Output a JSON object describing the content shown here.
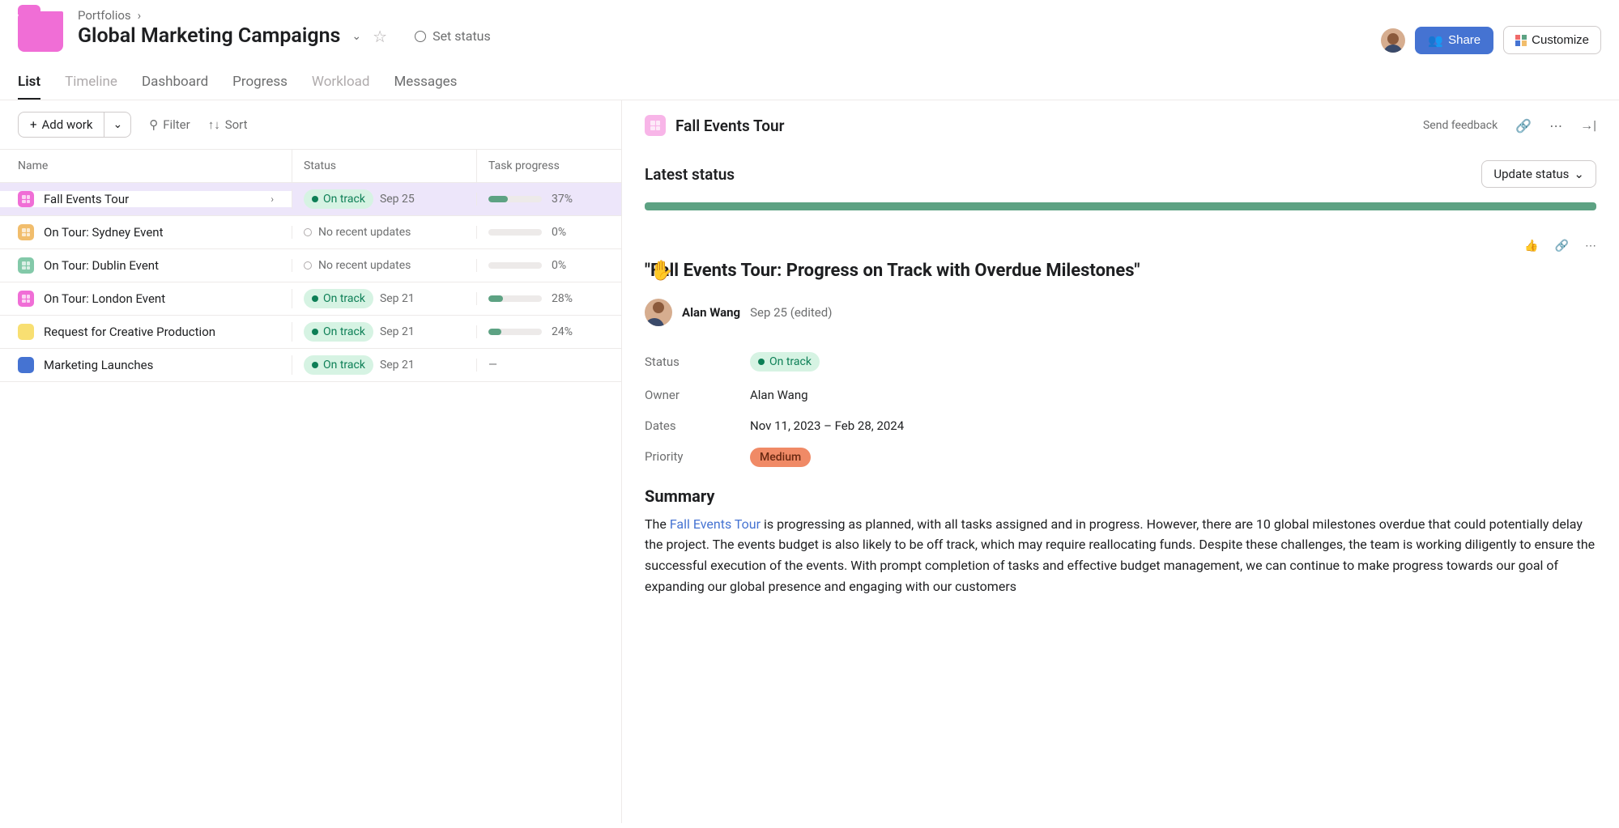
{
  "breadcrumb": {
    "parent": "Portfolios"
  },
  "page_title": "Global Marketing Campaigns",
  "set_status": "Set status",
  "share_label": "Share",
  "customize_label": "Customize",
  "tabs": {
    "list": "List",
    "timeline": "Timeline",
    "dashboard": "Dashboard",
    "progress": "Progress",
    "workload": "Workload",
    "messages": "Messages"
  },
  "toolbar": {
    "add_work": "Add work",
    "filter": "Filter",
    "sort": "Sort"
  },
  "columns": {
    "name": "Name",
    "status": "Status",
    "progress": "Task progress"
  },
  "rows": {
    "r0": {
      "name": "Fall Events Tour",
      "status_label": "On track",
      "status_date": "Sep 25",
      "pct": "37%",
      "fill": 37
    },
    "r1": {
      "name": "On Tour: Sydney Event",
      "nou": "No recent updates",
      "pct": "0%",
      "fill": 0
    },
    "r2": {
      "name": "On Tour: Dublin Event",
      "nou": "No recent updates",
      "pct": "0%",
      "fill": 0
    },
    "r3": {
      "name": "On Tour: London Event",
      "status_label": "On track",
      "status_date": "Sep 21",
      "pct": "28%",
      "fill": 28
    },
    "r4": {
      "name": "Request for Creative Production",
      "status_label": "On track",
      "status_date": "Sep 21",
      "pct": "24%",
      "fill": 24
    },
    "r5": {
      "name": "Marketing Launches",
      "status_label": "On track",
      "status_date": "Sep 21",
      "dash": "—"
    }
  },
  "detail": {
    "title": "Fall Events Tour",
    "send_feedback": "Send feedback",
    "latest_status": "Latest status",
    "update_status": "Update status",
    "update_title": "\"Fall Events Tour: Progress on Track with Overdue Milestones\"",
    "author": "Alan Wang",
    "author_date": "Sep 25 (edited)",
    "meta": {
      "status_label": "Status",
      "status_value": "On track",
      "owner_label": "Owner",
      "owner_value": "Alan Wang",
      "dates_label": "Dates",
      "dates_value": "Nov 11, 2023 – Feb 28, 2024",
      "priority_label": "Priority",
      "priority_value": "Medium"
    },
    "summary_heading": "Summary",
    "summary_pre": "The ",
    "summary_link": "Fall Events Tour",
    "summary_post": " is progressing as planned, with all tasks assigned and in progress. However, there are 10 global milestones overdue that could potentially delay the project. The events budget is also likely to be off track, which may require reallocating funds. Despite these challenges, the team is working diligently to ensure the successful execution of the events. With prompt completion of tasks and effective budget management, we can continue to make progress towards our goal of expanding our global presence and engaging with our customers"
  }
}
